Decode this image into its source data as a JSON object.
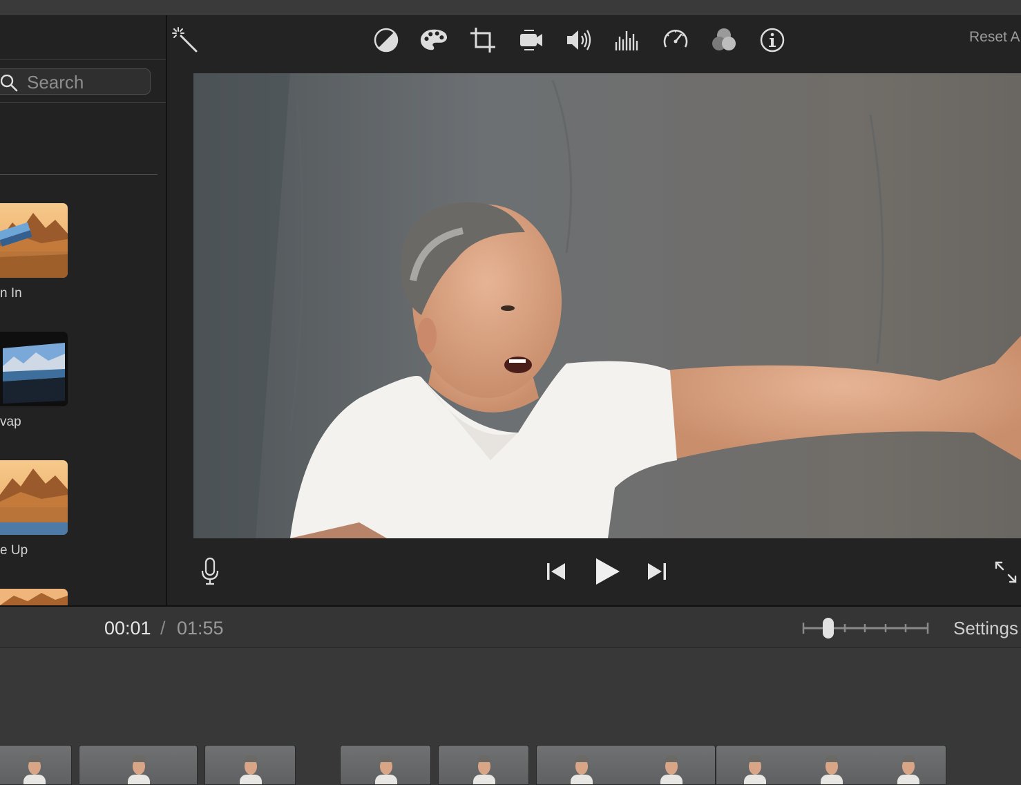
{
  "left_panel": {
    "search": {
      "placeholder": "Search",
      "value": ""
    },
    "transitions": [
      {
        "label": "n In"
      },
      {
        "label": "vap"
      },
      {
        "label": "e Up"
      },
      {
        "label": ""
      }
    ]
  },
  "viewer": {
    "toolbar": {
      "tools": [
        {
          "icon": "magic-wand-icon"
        },
        {
          "icon": "color-balance-icon"
        },
        {
          "icon": "color-palette-icon"
        },
        {
          "icon": "crop-icon"
        },
        {
          "icon": "stabilization-camera-icon"
        },
        {
          "icon": "volume-icon"
        },
        {
          "icon": "noise-reduction-equalizer-icon"
        },
        {
          "icon": "speed-icon"
        },
        {
          "icon": "clip-filter-icon"
        },
        {
          "icon": "info-icon"
        }
      ],
      "reset_label": "Reset A"
    },
    "playback": {
      "controls": [
        "microphone-icon",
        "skip-back-icon",
        "play-icon",
        "skip-forward-icon",
        "fullscreen-icon"
      ]
    }
  },
  "time_bar": {
    "current": "00:01",
    "separator": "/",
    "total": "01:55",
    "zoom_level": 0.2,
    "settings_label": "Settings"
  },
  "colors": {
    "panel_bg": "#222222",
    "viewer_bg": "#232323",
    "timeline_bg": "#383838",
    "time_bar_bg": "#353535"
  }
}
